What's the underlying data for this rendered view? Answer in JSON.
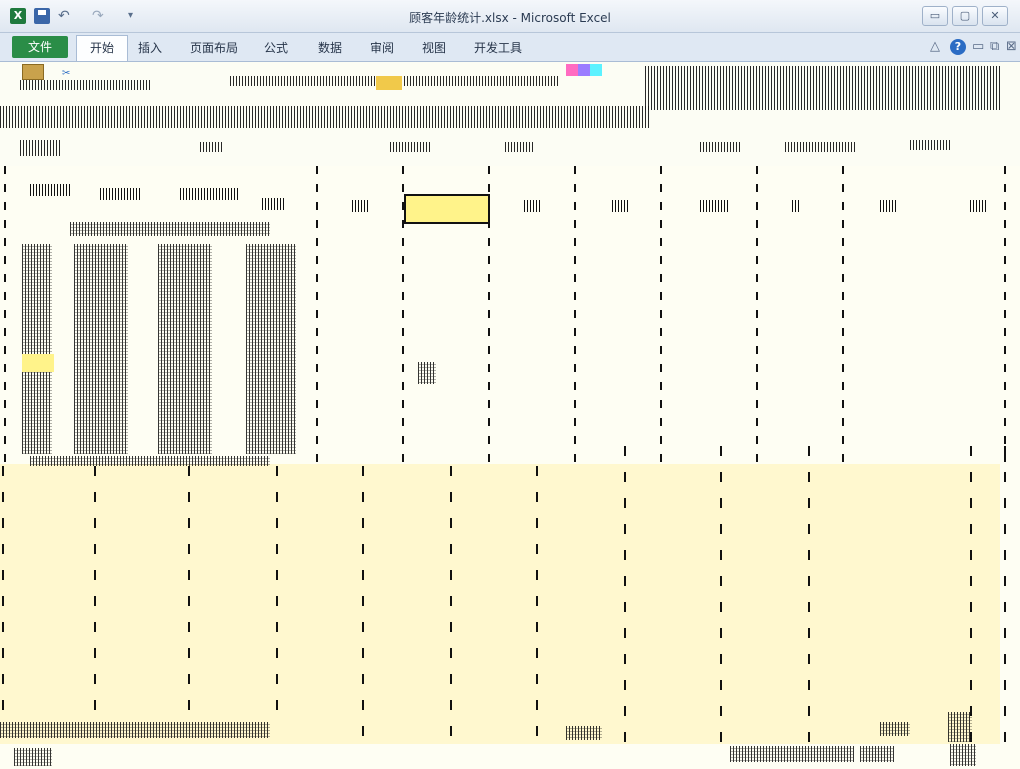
{
  "window": {
    "title": "顾客年龄统计.xlsx - Microsoft Excel",
    "app_logo": "X",
    "buttons": {
      "minimize": "▭",
      "maximize": "▢",
      "close": "✕"
    }
  },
  "quick_access": {
    "undo": "↶",
    "redo": "↷",
    "more": "▾"
  },
  "ribbon_tabs": [
    {
      "label": "文件",
      "id": "file"
    },
    {
      "label": "开始",
      "id": "home"
    },
    {
      "label": "插入",
      "id": "insert"
    },
    {
      "label": "页面布局",
      "id": "page-layout"
    },
    {
      "label": "公式",
      "id": "formulas"
    },
    {
      "label": "数据",
      "id": "data"
    },
    {
      "label": "审阅",
      "id": "review"
    },
    {
      "label": "视图",
      "id": "view"
    },
    {
      "label": "开发工具",
      "id": "developer"
    }
  ],
  "ribbon_right": {
    "collapse": "△",
    "help": "?",
    "min": "▭",
    "restore": "⧉",
    "close": "⊠"
  },
  "icons": [
    "excel-logo-icon",
    "save-icon",
    "undo-icon",
    "redo-icon",
    "help-icon",
    "paste-icon",
    "cut-icon"
  ],
  "colors": {
    "file_tab": "#2a8d47",
    "active_cell": "#fff38a",
    "selection": "#fff8cf"
  }
}
